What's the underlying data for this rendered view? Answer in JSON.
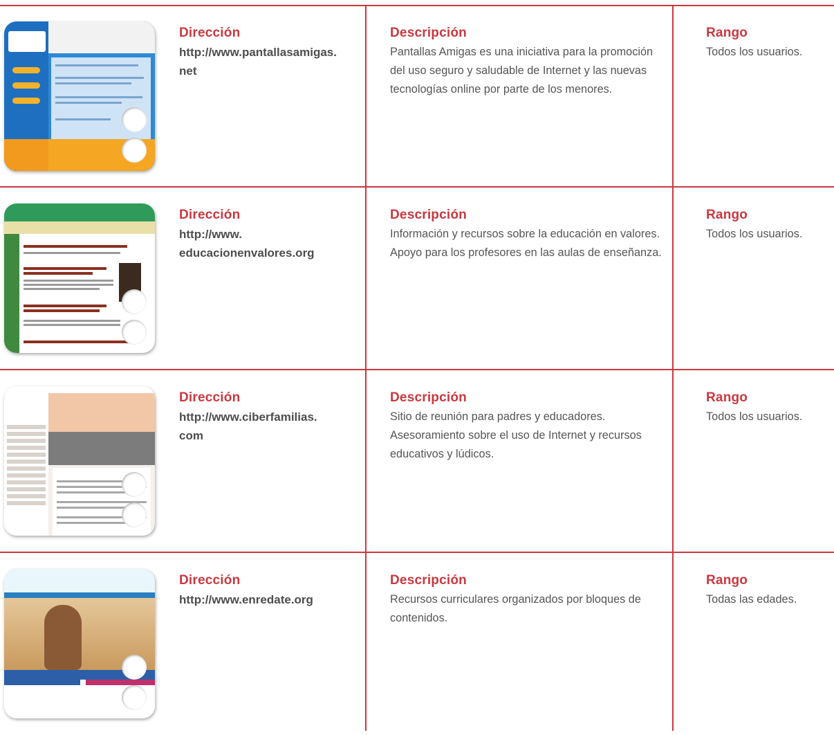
{
  "headings": {
    "address": "Dirección",
    "description": "Descripción",
    "range": "Rango"
  },
  "rows": [
    {
      "url": "http://www.pantallasamigas.net",
      "url_lines": [
        "http://www.pantallasamigas.",
        "net"
      ],
      "description": "Pantallas Amigas es una iniciativa para la promoción del uso seguro y saludable de Internet y las nuevas tecnologías online por parte de los menores.",
      "range": "Todos los usuarios.",
      "thumbnail": "pantallasamigas-screenshot"
    },
    {
      "url": "http://www.educacionenvalores.org",
      "url_lines": [
        "http://www.",
        "educacionenvalores.org"
      ],
      "description": "Información y recursos sobre la educación en valores. Apoyo para los profesores en las aulas de enseñanza.",
      "range": "Todos los usuarios.",
      "thumbnail": "educacionenvalores-screenshot"
    },
    {
      "url": "http://www.ciberfamilias.com",
      "url_lines": [
        "http://www.ciberfamilias.",
        "com"
      ],
      "description": "Sitio de reunión para padres y educadores. Asesoramiento sobre el uso de Internet y recursos educativos y lúdicos.",
      "range": "Todos los usuarios.",
      "thumbnail": "ciberfamilias-screenshot"
    },
    {
      "url": "http://www.enredate.org",
      "url_lines": [
        "http://www.enredate.org"
      ],
      "description": "Recursos curriculares organizados por bloques de contenidos.",
      "range": "Todas las edades.",
      "thumbnail": "enredate-screenshot"
    }
  ],
  "colors": {
    "accent": "#c9383f",
    "body_text": "#555555",
    "url_text": "#4d4d4d"
  }
}
